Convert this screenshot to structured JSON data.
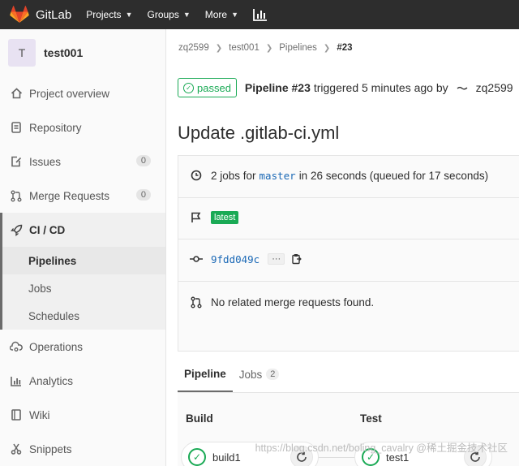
{
  "navbar": {
    "brand": "GitLab",
    "items": [
      {
        "label": "Projects",
        "chevron": "chevron-down-icon"
      },
      {
        "label": "Groups",
        "chevron": "chevron-down-icon"
      },
      {
        "label": "More",
        "chevron": "chevron-down-icon"
      }
    ],
    "chart_icon": "bar-chart-icon",
    "colors": {
      "bg": "#2d2d2d",
      "text": "#ffffff",
      "logo": "#fc6d26"
    }
  },
  "sidebar": {
    "avatar_letter": "T",
    "project_name": "test001",
    "items": [
      {
        "label": "Project overview",
        "icon": "home-icon"
      },
      {
        "label": "Repository",
        "icon": "document-icon"
      },
      {
        "label": "Issues",
        "icon": "issues-icon",
        "count": "0"
      },
      {
        "label": "Merge Requests",
        "icon": "merge-request-icon",
        "count": "0"
      },
      {
        "label": "CI / CD",
        "icon": "rocket-icon"
      },
      {
        "label": "Operations",
        "icon": "cloud-gear-icon"
      },
      {
        "label": "Analytics",
        "icon": "bar-chart-icon"
      },
      {
        "label": "Wiki",
        "icon": "book-icon"
      },
      {
        "label": "Snippets",
        "icon": "scissors-icon"
      }
    ],
    "cicd_sub": [
      {
        "label": "Pipelines"
      },
      {
        "label": "Jobs"
      },
      {
        "label": "Schedules"
      }
    ]
  },
  "breadcrumb": {
    "items": [
      "zq2599",
      "test001",
      "Pipelines"
    ],
    "current": "#23"
  },
  "pipeline": {
    "status": "passed",
    "link": "Pipeline #23",
    "triggered": "triggered 5 minutes ago by",
    "user": "zq2599",
    "title": "Update .gitlab-ci.yml",
    "jobs_prefix": "2 jobs for",
    "branch": "master",
    "jobs_suffix": "in 26 seconds (queued for 17 seconds)",
    "tag": "latest",
    "commit": "9fdd049c",
    "ellipsis": "···",
    "mr_text": "No related merge requests found.",
    "colors": {
      "success": "#1aaa55",
      "link": "#1b69b6"
    }
  },
  "tabs": [
    {
      "label": "Pipeline"
    },
    {
      "label": "Jobs",
      "count": "2"
    }
  ],
  "graph": {
    "stages": [
      {
        "name": "Build",
        "job": "build1"
      },
      {
        "name": "Test",
        "job": "test1"
      }
    ]
  },
  "watermark": "https://blog.csdn.net/boling_cavalry  @稀土掘金技术社区"
}
